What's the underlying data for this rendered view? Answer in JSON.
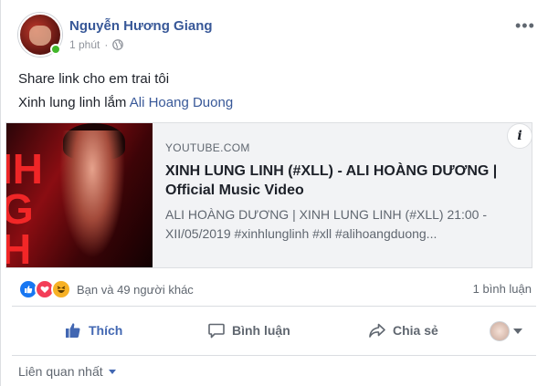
{
  "post": {
    "author": "Nguyễn Hương Giang",
    "time": "1 phút",
    "separator": "·",
    "text_line_1": "Share link cho em trai tôi",
    "text_line_2_prefix": "Xinh lung linh lắm",
    "mention": "Ali Hoang Duong",
    "more_icon": "more-icon",
    "audience_icon": "globe-icon"
  },
  "link_preview": {
    "domain": "YOUTUBE.COM",
    "title": "XINH LUNG LINH (#XLL) - ALI HOÀNG DƯƠNG | Official Music Video",
    "description": "ALI HOÀNG DƯƠNG | XINH LUNG LINH (#XLL) 21:00 - XII/05/2019 #xinhlunglinh #xll #alihoangduong...",
    "info_glyph": "i",
    "thumbnail_letters": "IH\nG\nH"
  },
  "reactions": {
    "types": [
      "like",
      "love",
      "haha"
    ],
    "summary": "Bạn và 49 người khác",
    "comment_count": "1 bình luận"
  },
  "actions": {
    "like": "Thích",
    "comment": "Bình luận",
    "share": "Chia sẻ"
  },
  "comments_sort": {
    "label": "Liên quan nhất"
  },
  "colors": {
    "link_blue": "#385898",
    "like_blue": "#4267b2",
    "secondary_text": "#606770",
    "online_green": "#42b72a"
  }
}
